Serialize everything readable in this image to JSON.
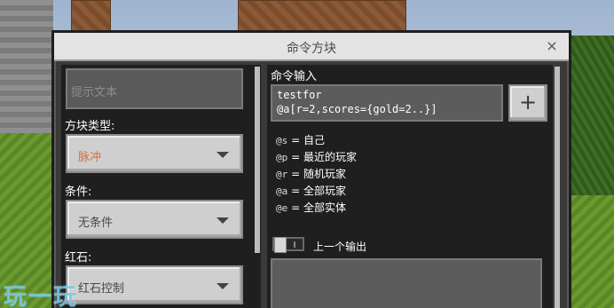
{
  "dialog": {
    "title": "命令方块",
    "close_glyph": "×"
  },
  "left": {
    "hover_text_placeholder": "提示文本",
    "block_type_label": "方块类型:",
    "block_type_value": "脉冲",
    "condition_label": "条件:",
    "condition_value": "无条件",
    "redstone_label": "红石:",
    "redstone_value": "红石控制"
  },
  "right": {
    "command_input_label": "命令输入",
    "command_text": "testfor\n@a[r=2,scores={gold=2..}]",
    "plus_glyph": "+",
    "selectors": [
      {
        "sel": "@s",
        "eq": " = ",
        "desc": "自己"
      },
      {
        "sel": "@p",
        "eq": " = ",
        "desc": "最近的玩家"
      },
      {
        "sel": "@r",
        "eq": " = ",
        "desc": "随机玩家"
      },
      {
        "sel": "@a",
        "eq": " = ",
        "desc": "全部玩家"
      },
      {
        "sel": "@e",
        "eq": " = ",
        "desc": "全部实体"
      }
    ],
    "previous_output_label": "上一个输出",
    "previous_output_enabled": false
  },
  "watermark": "玩一玩",
  "colors": {
    "dialog_bg": "#3a3a3a",
    "panel_bg": "#1f1f1f",
    "button_gray": "#cfcfcf",
    "accent_orange": "#d96a35"
  }
}
